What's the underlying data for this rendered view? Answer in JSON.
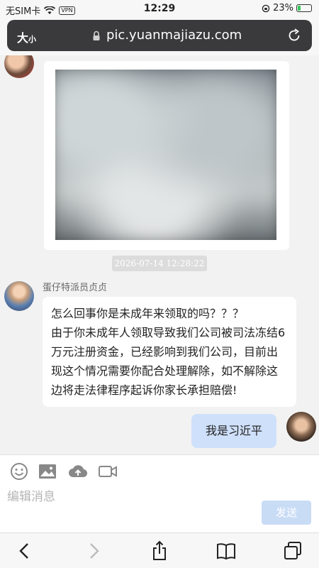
{
  "status_bar": {
    "carrier": "无SIM卡",
    "vpn": "VPN",
    "time": "12:29",
    "battery_percent": "23%",
    "battery_level": 0.23
  },
  "browser": {
    "text_size": "大",
    "text_size_small": "小",
    "url": "pic.yuanmajiazu.com"
  },
  "chat": {
    "timestamp": "2026-07-14 12:28:22",
    "sender_name": "蛋仔特派员贞贞",
    "incoming_message": {
      "line1": "怎么回事你是未成年来领取的吗？？？",
      "line2": "由于你未成年人领取导致我们公司被司法冻结6万元注册资金，已经影响到我们公司，目前出现这个情况需要你配合处理解除，如不解除这边将走法律程序起诉你家长承担赔偿!"
    },
    "outgoing_message": "我是习近平"
  },
  "composer": {
    "placeholder": "编辑消息",
    "send_label": "发送",
    "tools": [
      "emoji-icon",
      "image-icon",
      "upload-icon",
      "video-icon"
    ]
  },
  "toolbar": {
    "icons": [
      "back-icon",
      "forward-icon",
      "share-icon",
      "bookmarks-icon",
      "tabs-icon"
    ]
  },
  "colors": {
    "outgoing_bubble": "#cfe0fb",
    "send_button": "#c9dcf6",
    "url_bar": "#3a3a3c"
  }
}
